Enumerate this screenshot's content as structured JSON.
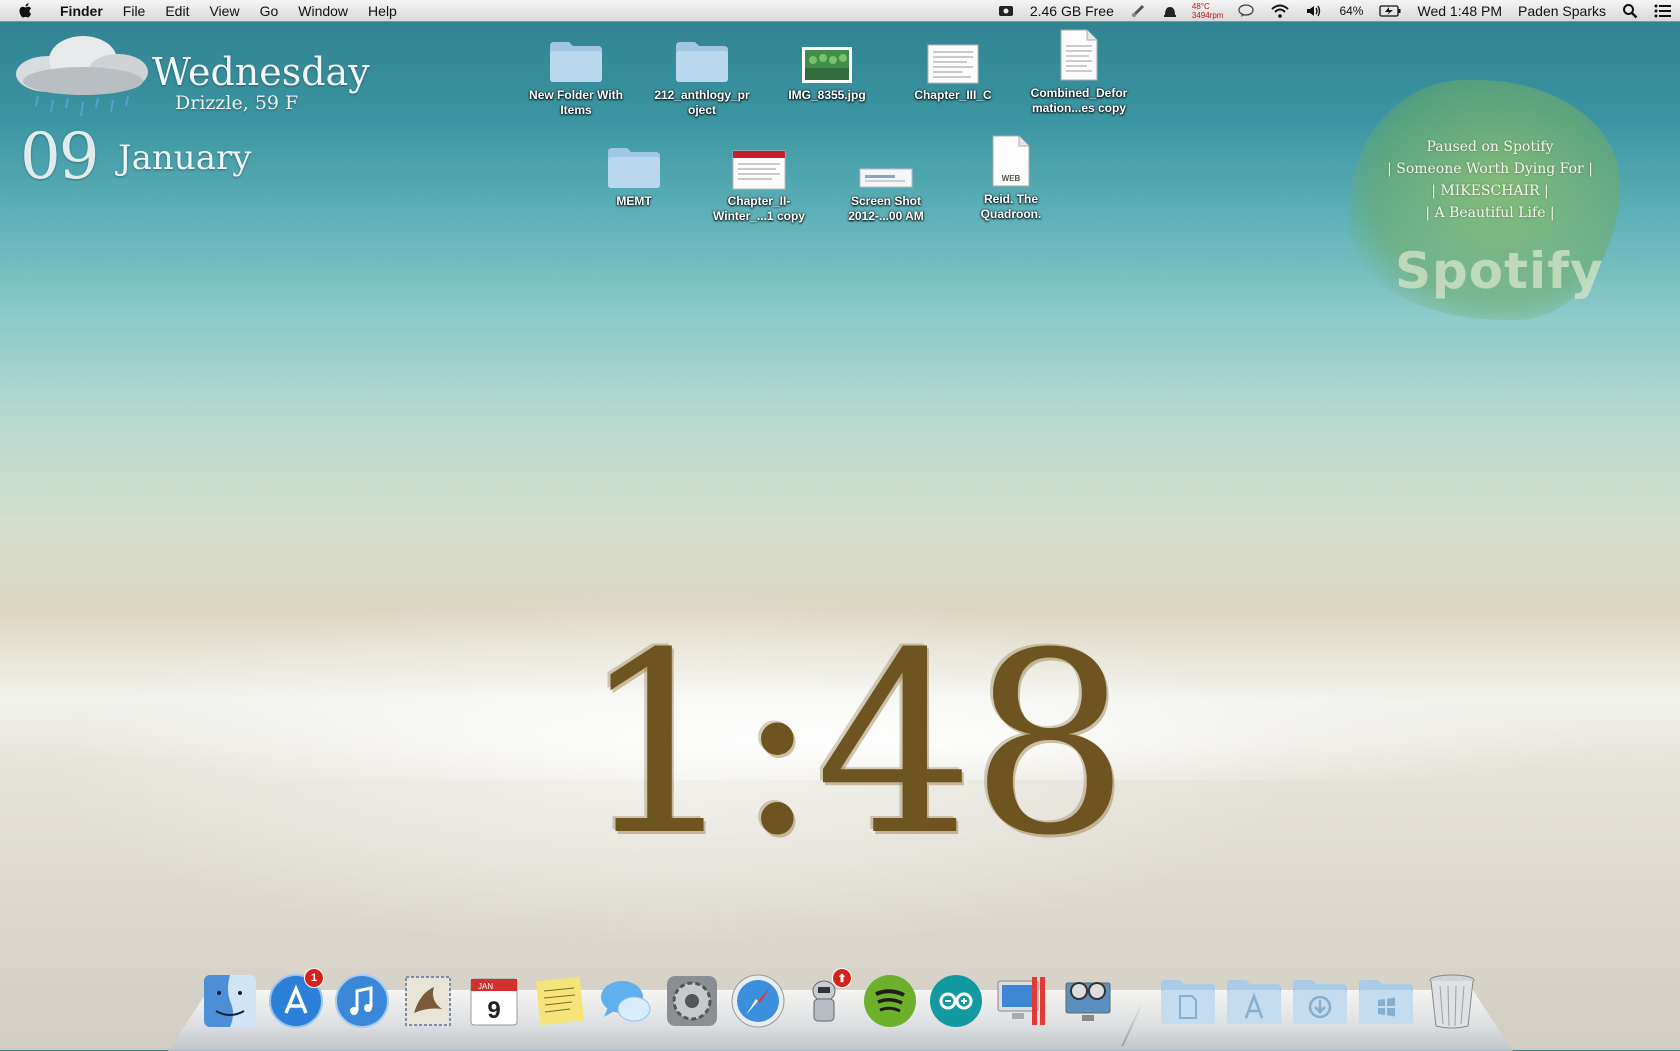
{
  "menubar": {
    "app_name": "Finder",
    "menus": [
      "File",
      "Edit",
      "View",
      "Go",
      "Window",
      "Help"
    ],
    "status": {
      "disk_free": "2.46 GB Free",
      "temp": "48°C",
      "fan": "3494rpm",
      "battery": "64%",
      "clock": "Wed 1:48 PM",
      "user": "Paden Sparks"
    }
  },
  "weather": {
    "day": "Wednesday",
    "condition": "Drizzle, 59 F",
    "date_num": "09",
    "month": "January"
  },
  "desktop": {
    "icons": [
      {
        "label1": "New Folder With",
        "label2": "Items",
        "kind": "folder-icon"
      },
      {
        "label1": "212_anthlogy_pr",
        "label2": "oject",
        "kind": "folder-icon"
      },
      {
        "label1": "IMG_8355.jpg",
        "label2": "",
        "kind": "photo-icon"
      },
      {
        "label1": "Chapter_III_C",
        "label2": "",
        "kind": "document-icon"
      },
      {
        "label1": "Combined_Defor",
        "label2": "mation...es copy",
        "kind": "document-icon"
      },
      {
        "label1": "MEMT",
        "label2": "",
        "kind": "folder-icon"
      },
      {
        "label1": "Chapter_II-",
        "label2": "Winter_...1 copy",
        "kind": "pdf-icon"
      },
      {
        "label1": "Screen Shot",
        "label2": "2012-...00 AM",
        "kind": "screenshot-icon"
      },
      {
        "label1": "Reid. The",
        "label2": "Quadroon.",
        "kind": "webarchive-icon"
      }
    ],
    "web_tag": "WEB",
    "jan_label": "JAN"
  },
  "spotify": {
    "line1": "Paused on Spotify",
    "line2": "| Someone Worth Dying For |",
    "line3": "| MIKESCHAIR |",
    "line4": "| A Beautiful Life |",
    "logo": "Spotify"
  },
  "clock_widget": {
    "time": "1:48"
  },
  "dock": {
    "items": [
      "finder-icon",
      "app-store-icon",
      "itunes-icon",
      "mail-icon",
      "calendar-icon",
      "stickies-icon",
      "messages-icon",
      "system-preferences-icon",
      "safari-icon",
      "automator-icon",
      "spotify-icon",
      "arduino-icon",
      "boot-camp-icon",
      "screen-sharing-icon",
      "documents-stack-icon",
      "applications-stack-icon",
      "downloads-stack-icon",
      "windows-stack-icon",
      "trash-icon"
    ],
    "app_store_badge": "1",
    "calendar_day": "9"
  }
}
